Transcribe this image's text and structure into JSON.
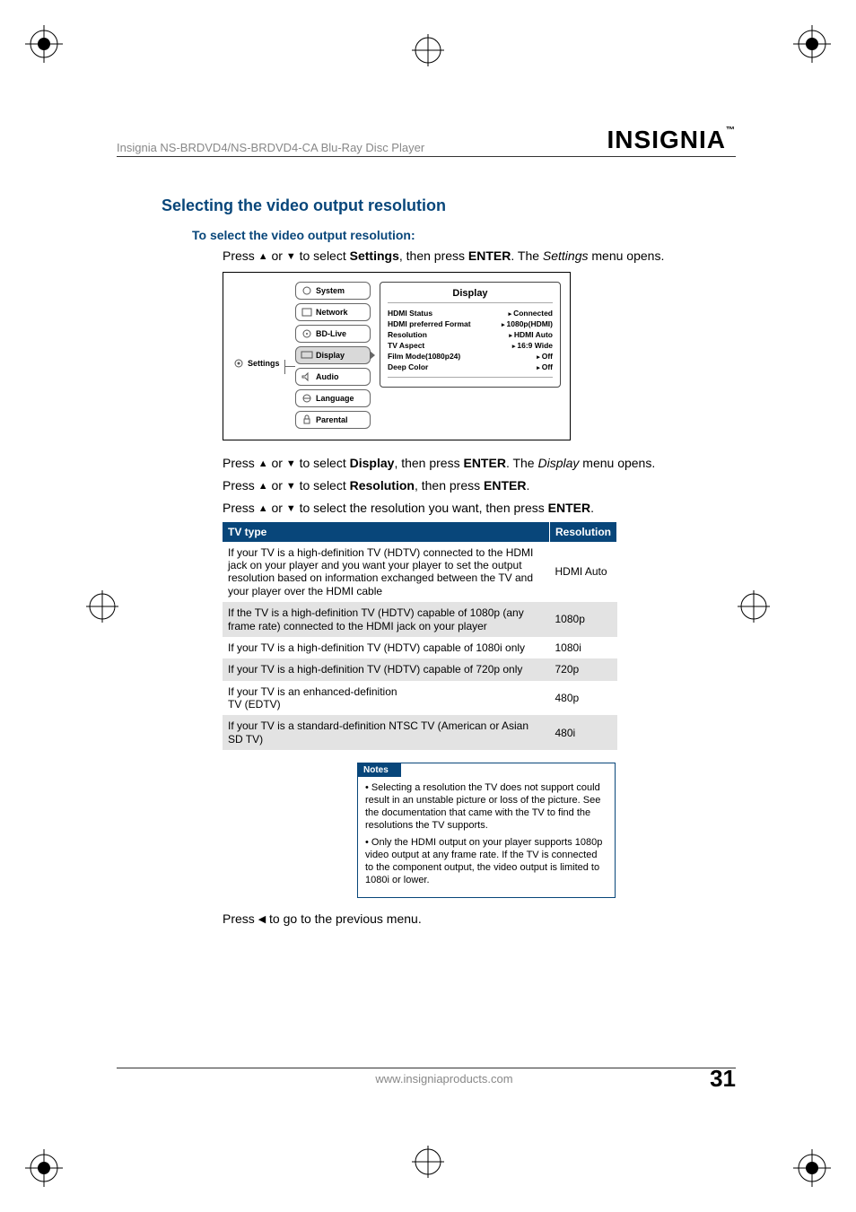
{
  "header": {
    "product_line": "Insignia NS-BRDVD4/NS-BRDVD4-CA Blu-Ray Disc Player",
    "brand": "INSIGNIA",
    "brand_tm": "™"
  },
  "section": {
    "title": "Selecting the video output resolution",
    "subhead": "To select the video output resolution:",
    "step1_a": "Press ",
    "step1_b": " or ",
    "step1_c": " to select ",
    "step1_bold": "Settings",
    "step1_d": ", then press ",
    "step1_bold2": "ENTER",
    "step1_e": ". The ",
    "step1_italic": "Settings",
    "step1_f": " menu opens.",
    "step2_a": "Press ",
    "step2_b": " or ",
    "step2_c": " to select ",
    "step2_bold": "Display",
    "step2_d": ", then press ",
    "step2_bold2": "ENTER",
    "step2_e": ". The ",
    "step2_italic": "Display",
    "step2_f": " menu opens.",
    "step3_a": "Press ",
    "step3_b": " or ",
    "step3_c": " to select ",
    "step3_bold": "Resolution",
    "step3_d": ", then press ",
    "step3_bold2": "ENTER",
    "step3_e": ".",
    "step4_a": "Press ",
    "step4_b": " or ",
    "step4_c": " to select the resolution you want, then press ",
    "step4_bold": "ENTER",
    "step4_d": ".",
    "step5_a": "Press ",
    "step5_b": " to go to the previous menu."
  },
  "osd": {
    "root_label": "Settings",
    "menu": [
      "System",
      "Network",
      "BD-Live",
      "Display",
      "Audio",
      "Language",
      "Parental"
    ],
    "panel_title": "Display",
    "rows": [
      {
        "k": "HDMI Status",
        "v": "Connected"
      },
      {
        "k": "HDMI preferred Format",
        "v": "1080p(HDMI)"
      },
      {
        "k": "Resolution",
        "v": "HDMI Auto"
      },
      {
        "k": "TV Aspect",
        "v": "16:9 Wide"
      },
      {
        "k": "Film Mode(1080p24)",
        "v": "Off"
      },
      {
        "k": "Deep Color",
        "v": "Off"
      }
    ]
  },
  "table": {
    "head_tv": "TV type",
    "head_res": "Resolution",
    "rows": [
      {
        "tv": "If your TV is a high-definition TV (HDTV) connected to the HDMI jack on your player and you want your player to set the output resolution based on information exchanged between the TV and your player over the HDMI cable",
        "res": "HDMI Auto"
      },
      {
        "tv": "If the TV is a high-definition TV (HDTV) capable of 1080p (any frame rate) connected to the HDMI jack on your player",
        "res": "1080p"
      },
      {
        "tv": "If your TV is a high-definition TV (HDTV) capable of 1080i only",
        "res": "1080i"
      },
      {
        "tv": "If your TV is a high-definition TV (HDTV) capable of 720p only",
        "res": "720p"
      },
      {
        "tv": "If your TV is an enhanced-definition\nTV (EDTV)",
        "res": "480p"
      },
      {
        "tv": "If your TV is a standard-definition NTSC TV (American or Asian SD TV)",
        "res": "480i"
      }
    ]
  },
  "notes": {
    "title": "Notes",
    "items": [
      "Selecting a resolution the TV does not support could result in an unstable picture or loss of the picture. See the documentation that came with the TV to find the resolutions the TV supports.",
      "Only the HDMI output on your player supports 1080p video output at any frame rate. If the TV is connected to the component output, the video output is limited to 1080i or lower."
    ]
  },
  "footer": {
    "url": "www.insigniaproducts.com",
    "page": "31"
  },
  "chart_data": {
    "type": "table",
    "title": "Video output resolution by TV type",
    "columns": [
      "TV type",
      "Resolution"
    ],
    "rows": [
      [
        "HDTV connected to HDMI jack, player auto-sets resolution via HDMI info exchange",
        "HDMI Auto"
      ],
      [
        "HDTV capable of 1080p (any frame rate) connected to HDMI jack",
        "1080p"
      ],
      [
        "HDTV capable of 1080i only",
        "1080i"
      ],
      [
        "HDTV capable of 720p only",
        "720p"
      ],
      [
        "Enhanced-definition TV (EDTV)",
        "480p"
      ],
      [
        "Standard-definition NTSC TV (American or Asian SD TV)",
        "480i"
      ]
    ]
  },
  "glyphs": {
    "up": "▲",
    "down": "▼",
    "left": "◀"
  }
}
